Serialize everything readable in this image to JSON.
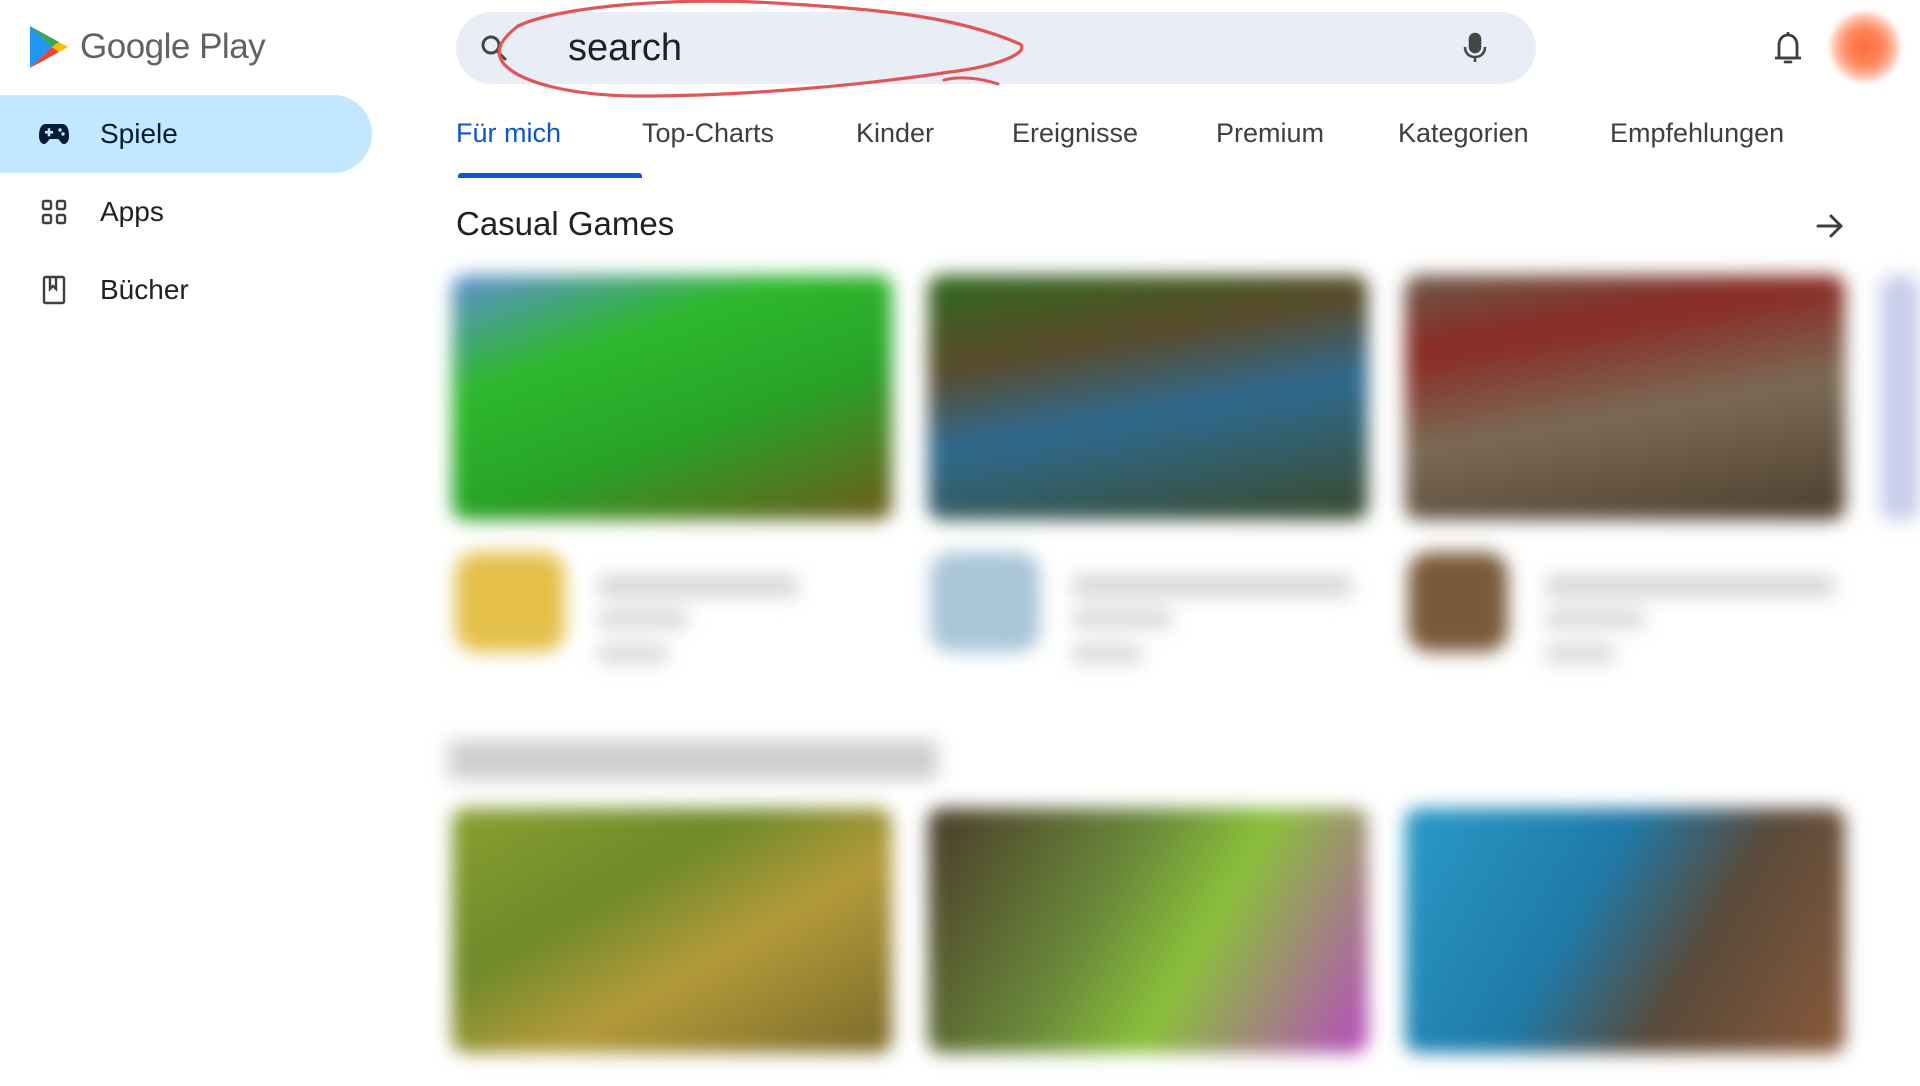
{
  "brand": {
    "name": "Google Play"
  },
  "sidebar": {
    "items": [
      {
        "label": "Spiele",
        "icon": "gamepad-icon",
        "active": true
      },
      {
        "label": "Apps",
        "icon": "apps-grid-icon",
        "active": false
      },
      {
        "label": "Bücher",
        "icon": "bookmark-book-icon",
        "active": false
      }
    ]
  },
  "search": {
    "value": "search",
    "placeholder": "search"
  },
  "tabs": [
    {
      "label": "Für mich",
      "active": true
    },
    {
      "label": "Top-Charts",
      "active": false
    },
    {
      "label": "Kinder",
      "active": false
    },
    {
      "label": "Ereignisse",
      "active": false
    },
    {
      "label": "Premium",
      "active": false
    },
    {
      "label": "Kategorien",
      "active": false
    },
    {
      "label": "Empfehlungen",
      "active": false
    }
  ],
  "section": {
    "title": "Casual Games"
  },
  "colors": {
    "accent": "#0b57d0",
    "active_nav_bg": "#c2e7ff",
    "search_bg": "#e8edf6",
    "annotation_red": "#e05555"
  }
}
